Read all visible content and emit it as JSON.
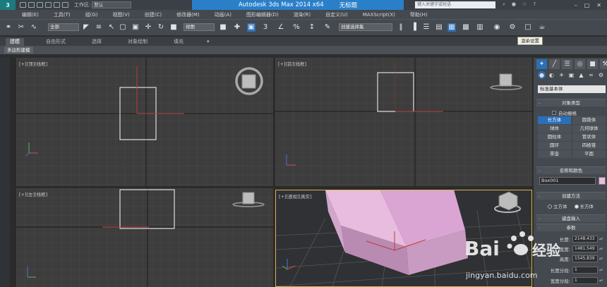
{
  "title_bar": {
    "workspace_label": "工作区:",
    "workspace_value": "默认",
    "app_title": "Autodesk 3ds Max  2014 x64",
    "doc_title": "无标题",
    "search_placeholder": "键入关键字或短语"
  },
  "menu": [
    "编辑(E)",
    "工具(T)",
    "组(G)",
    "视图(V)",
    "创建(C)",
    "修改器(M)",
    "动画(A)",
    "图形编辑器(D)",
    "渲染(R)",
    "自定义(U)",
    "MAXScript(X)",
    "帮助(H)"
  ],
  "toolbar": {
    "filter_select": "全部",
    "coord_select": "视图",
    "selection_set": "创建选择集",
    "tooltip": "渲染设置"
  },
  "ribbon": {
    "tabs": [
      "建模",
      "自由形式",
      "选择",
      "对象绘制",
      "填充"
    ],
    "active_tab": "建模",
    "sub_label": "多边形建模"
  },
  "viewports": [
    {
      "label": "[+][顶][线框]"
    },
    {
      "label": "[+][前][线框]"
    },
    {
      "label": "[+][左][线框]"
    },
    {
      "label": "[+][透视][真实]"
    }
  ],
  "command_panel": {
    "category": "标准基本体",
    "object_type_title": "对象类型",
    "autogrid_label": "自动栅格",
    "objects": [
      "长方体",
      "圆锥体",
      "球体",
      "几何球体",
      "圆柱体",
      "管状体",
      "圆环",
      "四棱锥",
      "茶壶",
      "平面"
    ],
    "active_object": "长方体",
    "name_color_title": "名称和颜色",
    "object_name": "Box001",
    "creation_method_title": "创建方法",
    "creation_options": [
      "立方体",
      "长方体"
    ],
    "creation_selected": "长方体",
    "keyboard_input_title": "键盘输入",
    "params_title": "参数",
    "params": [
      {
        "label": "长度:",
        "value": "2148.433"
      },
      {
        "label": "宽度:",
        "value": "1481.549"
      },
      {
        "label": "高度:",
        "value": "1545.839"
      },
      {
        "label": "长度分段:",
        "value": "1"
      },
      {
        "label": "宽度分段:",
        "value": "1"
      }
    ]
  },
  "watermark": {
    "brand": "Bai 经验",
    "url": "jingyan.baidu.com"
  },
  "colors": {
    "accent": "#2a6fb8",
    "title_blue": "#2a7fc9",
    "box_pink": "#e9bde1",
    "active_border": "#d9b64a"
  }
}
